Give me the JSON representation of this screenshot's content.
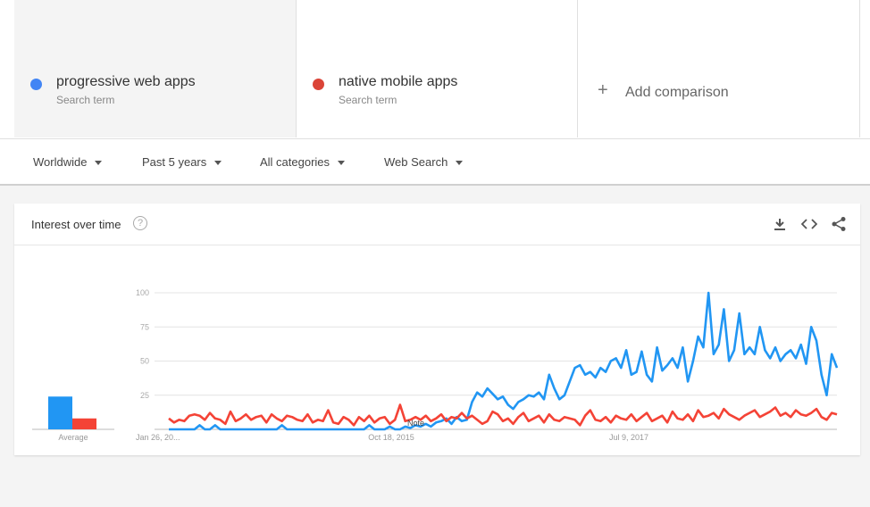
{
  "terms": [
    {
      "name": "progressive web apps",
      "sub": "Search term",
      "color": "#4285f4"
    },
    {
      "name": "native mobile apps",
      "sub": "Search term",
      "color": "#db4437"
    }
  ],
  "add_comparison": "Add comparison",
  "filters": {
    "region": "Worldwide",
    "time": "Past 5 years",
    "category": "All categories",
    "type": "Web Search"
  },
  "card": {
    "title": "Interest over time",
    "help": "?",
    "icons": [
      "download-icon",
      "embed-icon",
      "share-icon"
    ]
  },
  "chart_data": {
    "type": "line",
    "ylim": [
      0,
      100
    ],
    "yticks": [
      "100",
      "75",
      "50",
      "25"
    ],
    "xtick_labels": [
      "Jan 26, 20...",
      "Oct 18, 2015",
      "Jul 9, 2017"
    ],
    "average_label": "Average",
    "average": [
      24,
      8
    ],
    "note_label": "Note",
    "grid": true,
    "series_colors": [
      "#2196f3",
      "#f44336"
    ],
    "series": [
      {
        "name": "progressive web apps",
        "values": [
          0,
          0,
          0,
          0,
          0,
          0,
          3,
          0,
          0,
          3,
          0,
          0,
          0,
          0,
          0,
          0,
          0,
          0,
          0,
          0,
          0,
          0,
          3,
          0,
          0,
          0,
          0,
          0,
          0,
          0,
          0,
          0,
          0,
          0,
          0,
          0,
          0,
          0,
          0,
          3,
          0,
          0,
          0,
          2,
          0,
          0,
          2,
          1,
          3,
          2,
          4,
          2,
          5,
          6,
          8,
          4,
          9,
          6,
          7,
          20,
          27,
          24,
          30,
          26,
          22,
          24,
          18,
          15,
          20,
          22,
          25,
          24,
          27,
          22,
          40,
          30,
          22,
          25,
          35,
          45,
          47,
          40,
          42,
          38,
          45,
          42,
          50,
          52,
          45,
          58,
          40,
          42,
          57,
          40,
          35,
          60,
          43,
          47,
          52,
          45,
          60,
          35,
          50,
          68,
          60,
          100,
          55,
          62,
          88,
          50,
          58,
          85,
          55,
          60,
          55,
          75,
          58,
          52,
          60,
          50,
          55,
          58,
          52,
          62,
          48,
          75,
          65,
          40,
          25,
          55,
          45
        ]
      },
      {
        "name": "native mobile apps",
        "values": [
          8,
          5,
          7,
          6,
          10,
          11,
          10,
          7,
          12,
          8,
          7,
          4,
          13,
          6,
          8,
          11,
          7,
          9,
          10,
          5,
          11,
          8,
          6,
          10,
          9,
          7,
          6,
          11,
          5,
          7,
          6,
          14,
          5,
          4,
          9,
          7,
          3,
          9,
          6,
          10,
          5,
          8,
          9,
          4,
          7,
          18,
          6,
          7,
          9,
          7,
          10,
          6,
          8,
          11,
          6,
          9,
          8,
          12,
          8,
          10,
          7,
          4,
          6,
          13,
          11,
          6,
          8,
          4,
          9,
          12,
          6,
          8,
          10,
          5,
          11,
          7,
          6,
          9,
          8,
          7,
          3,
          10,
          14,
          7,
          6,
          9,
          5,
          10,
          8,
          7,
          11,
          6,
          9,
          12,
          6,
          8,
          10,
          5,
          13,
          8,
          7,
          11,
          6,
          14,
          9,
          10,
          12,
          8,
          15,
          11,
          9,
          7,
          10,
          12,
          14,
          9,
          11,
          13,
          16,
          10,
          12,
          9,
          14,
          11,
          10,
          12,
          15,
          9,
          7,
          12,
          11
        ]
      }
    ]
  }
}
